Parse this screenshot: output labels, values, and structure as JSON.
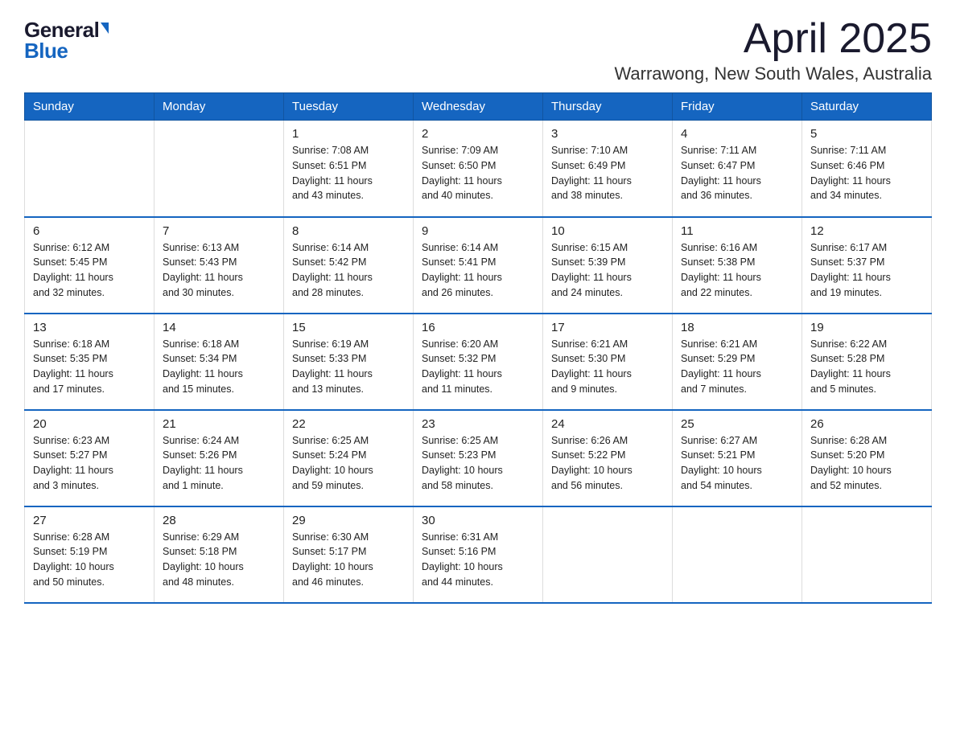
{
  "header": {
    "logo_general": "General",
    "logo_blue": "Blue",
    "title": "April 2025",
    "subtitle": "Warrawong, New South Wales, Australia"
  },
  "weekdays": [
    "Sunday",
    "Monday",
    "Tuesday",
    "Wednesday",
    "Thursday",
    "Friday",
    "Saturday"
  ],
  "weeks": [
    [
      {
        "day": "",
        "info": ""
      },
      {
        "day": "",
        "info": ""
      },
      {
        "day": "1",
        "info": "Sunrise: 7:08 AM\nSunset: 6:51 PM\nDaylight: 11 hours\nand 43 minutes."
      },
      {
        "day": "2",
        "info": "Sunrise: 7:09 AM\nSunset: 6:50 PM\nDaylight: 11 hours\nand 40 minutes."
      },
      {
        "day": "3",
        "info": "Sunrise: 7:10 AM\nSunset: 6:49 PM\nDaylight: 11 hours\nand 38 minutes."
      },
      {
        "day": "4",
        "info": "Sunrise: 7:11 AM\nSunset: 6:47 PM\nDaylight: 11 hours\nand 36 minutes."
      },
      {
        "day": "5",
        "info": "Sunrise: 7:11 AM\nSunset: 6:46 PM\nDaylight: 11 hours\nand 34 minutes."
      }
    ],
    [
      {
        "day": "6",
        "info": "Sunrise: 6:12 AM\nSunset: 5:45 PM\nDaylight: 11 hours\nand 32 minutes."
      },
      {
        "day": "7",
        "info": "Sunrise: 6:13 AM\nSunset: 5:43 PM\nDaylight: 11 hours\nand 30 minutes."
      },
      {
        "day": "8",
        "info": "Sunrise: 6:14 AM\nSunset: 5:42 PM\nDaylight: 11 hours\nand 28 minutes."
      },
      {
        "day": "9",
        "info": "Sunrise: 6:14 AM\nSunset: 5:41 PM\nDaylight: 11 hours\nand 26 minutes."
      },
      {
        "day": "10",
        "info": "Sunrise: 6:15 AM\nSunset: 5:39 PM\nDaylight: 11 hours\nand 24 minutes."
      },
      {
        "day": "11",
        "info": "Sunrise: 6:16 AM\nSunset: 5:38 PM\nDaylight: 11 hours\nand 22 minutes."
      },
      {
        "day": "12",
        "info": "Sunrise: 6:17 AM\nSunset: 5:37 PM\nDaylight: 11 hours\nand 19 minutes."
      }
    ],
    [
      {
        "day": "13",
        "info": "Sunrise: 6:18 AM\nSunset: 5:35 PM\nDaylight: 11 hours\nand 17 minutes."
      },
      {
        "day": "14",
        "info": "Sunrise: 6:18 AM\nSunset: 5:34 PM\nDaylight: 11 hours\nand 15 minutes."
      },
      {
        "day": "15",
        "info": "Sunrise: 6:19 AM\nSunset: 5:33 PM\nDaylight: 11 hours\nand 13 minutes."
      },
      {
        "day": "16",
        "info": "Sunrise: 6:20 AM\nSunset: 5:32 PM\nDaylight: 11 hours\nand 11 minutes."
      },
      {
        "day": "17",
        "info": "Sunrise: 6:21 AM\nSunset: 5:30 PM\nDaylight: 11 hours\nand 9 minutes."
      },
      {
        "day": "18",
        "info": "Sunrise: 6:21 AM\nSunset: 5:29 PM\nDaylight: 11 hours\nand 7 minutes."
      },
      {
        "day": "19",
        "info": "Sunrise: 6:22 AM\nSunset: 5:28 PM\nDaylight: 11 hours\nand 5 minutes."
      }
    ],
    [
      {
        "day": "20",
        "info": "Sunrise: 6:23 AM\nSunset: 5:27 PM\nDaylight: 11 hours\nand 3 minutes."
      },
      {
        "day": "21",
        "info": "Sunrise: 6:24 AM\nSunset: 5:26 PM\nDaylight: 11 hours\nand 1 minute."
      },
      {
        "day": "22",
        "info": "Sunrise: 6:25 AM\nSunset: 5:24 PM\nDaylight: 10 hours\nand 59 minutes."
      },
      {
        "day": "23",
        "info": "Sunrise: 6:25 AM\nSunset: 5:23 PM\nDaylight: 10 hours\nand 58 minutes."
      },
      {
        "day": "24",
        "info": "Sunrise: 6:26 AM\nSunset: 5:22 PM\nDaylight: 10 hours\nand 56 minutes."
      },
      {
        "day": "25",
        "info": "Sunrise: 6:27 AM\nSunset: 5:21 PM\nDaylight: 10 hours\nand 54 minutes."
      },
      {
        "day": "26",
        "info": "Sunrise: 6:28 AM\nSunset: 5:20 PM\nDaylight: 10 hours\nand 52 minutes."
      }
    ],
    [
      {
        "day": "27",
        "info": "Sunrise: 6:28 AM\nSunset: 5:19 PM\nDaylight: 10 hours\nand 50 minutes."
      },
      {
        "day": "28",
        "info": "Sunrise: 6:29 AM\nSunset: 5:18 PM\nDaylight: 10 hours\nand 48 minutes."
      },
      {
        "day": "29",
        "info": "Sunrise: 6:30 AM\nSunset: 5:17 PM\nDaylight: 10 hours\nand 46 minutes."
      },
      {
        "day": "30",
        "info": "Sunrise: 6:31 AM\nSunset: 5:16 PM\nDaylight: 10 hours\nand 44 minutes."
      },
      {
        "day": "",
        "info": ""
      },
      {
        "day": "",
        "info": ""
      },
      {
        "day": "",
        "info": ""
      }
    ]
  ]
}
